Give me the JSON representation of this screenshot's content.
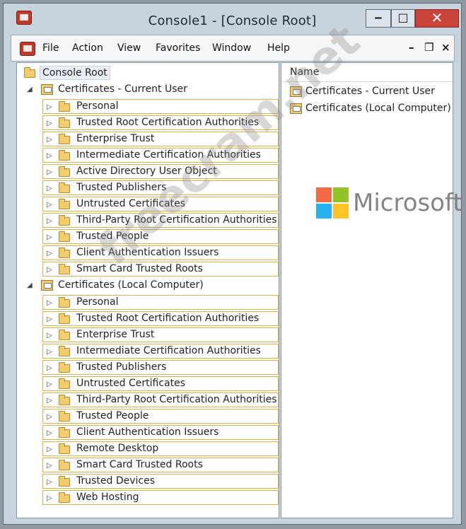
{
  "window": {
    "title": "Console1 - [Console Root]",
    "minimize_glyph": "‒",
    "maximize_glyph": "□",
    "close_glyph": "✕"
  },
  "menu": {
    "items": [
      "File",
      "Action",
      "View",
      "Favorites",
      "Window",
      "Help"
    ],
    "mdi_minimize": "–",
    "mdi_restore": "❐",
    "mdi_close": "×"
  },
  "tree": {
    "root": "Console Root",
    "groups": [
      {
        "label": "Certificates - Current User",
        "items": [
          "Personal",
          "Trusted Root Certification Authorities",
          "Enterprise Trust",
          "Intermediate Certification Authorities",
          "Active Directory User Object",
          "Trusted Publishers",
          "Untrusted Certificates",
          "Third-Party Root Certification Authorities",
          "Trusted People",
          "Client Authentication Issuers",
          "Smart Card Trusted Roots"
        ]
      },
      {
        "label": "Certificates (Local Computer)",
        "items": [
          "Personal",
          "Trusted Root Certification Authorities",
          "Enterprise Trust",
          "Intermediate Certification Authorities",
          "Trusted Publishers",
          "Untrusted Certificates",
          "Third-Party Root Certification Authorities",
          "Trusted People",
          "Client Authentication Issuers",
          "Remote Desktop",
          "Smart Card Trusted Roots",
          "Trusted Devices",
          "Web Hosting"
        ]
      }
    ],
    "expand_glyph": "◢",
    "collapsed_glyph": "▷"
  },
  "list": {
    "column_header": "Name",
    "rows": [
      "Certificates - Current User",
      "Certificates (Local Computer)"
    ]
  },
  "watermark": {
    "text": "freecram.net",
    "brand": "Microsoft",
    "logo_colors": [
      "#f25022",
      "#7fba00",
      "#00a4ef",
      "#ffb900"
    ]
  }
}
